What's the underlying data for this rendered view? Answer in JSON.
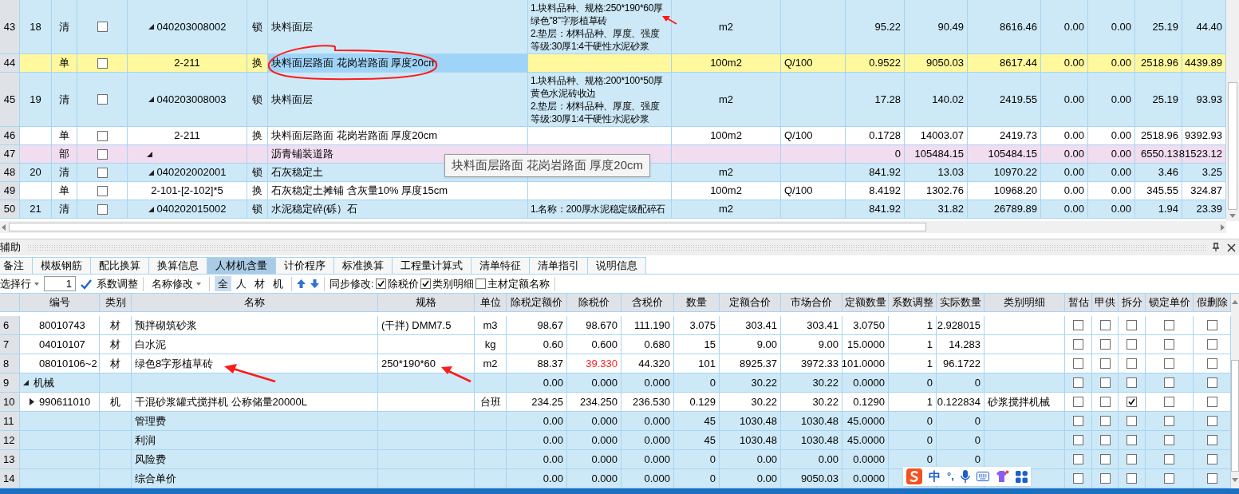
{
  "top_table": {
    "rows": [
      {
        "row": "43",
        "seq": "18",
        "type": "清",
        "kind": "list",
        "selected": false,
        "checked": false,
        "expanded": true,
        "code": "040203008002",
        "lock": "锁",
        "name": "块料面层",
        "desc": [
          "1.块料品种、规格:250*190*60厚",
          "绿色\"8\"字形植草砖",
          "2.垫层：材料品种、厚度、强度",
          "等级:30厚1:4干硬性水泥砂浆"
        ],
        "unit": "m2",
        "expr": "",
        "values": [
          "95.22",
          "90.49",
          "8616.46",
          "0.00",
          "0.00",
          "25.19",
          "44.40"
        ]
      },
      {
        "row": "44",
        "seq": "",
        "type": "单",
        "kind": "quota",
        "selected": true,
        "checked": false,
        "code": "2-211",
        "lock": "换",
        "name": "块料面层路面 花岗岩路面 厚度20cm",
        "desc": [],
        "unit": "100m2",
        "expr": "Q/100",
        "values": [
          "0.9522",
          "9050.03",
          "8617.44",
          "0.00",
          "0.00",
          "2518.96",
          "4439.89"
        ]
      },
      {
        "row": "45",
        "seq": "19",
        "type": "清",
        "kind": "list",
        "selected": false,
        "checked": false,
        "expanded": true,
        "code": "040203008003",
        "lock": "锁",
        "name": "块料面层",
        "desc": [
          "1.块料品种、规格:200*100*50厚",
          "黄色水泥砖收边",
          "2.垫层：材料品种、厚度、强度",
          "等级:30厚1:4干硬性水泥砂浆"
        ],
        "unit": "m2",
        "expr": "",
        "values": [
          "17.28",
          "140.02",
          "2419.55",
          "0.00",
          "0.00",
          "25.19",
          "93.93"
        ]
      },
      {
        "row": "46",
        "seq": "",
        "type": "单",
        "kind": "quota",
        "selected": false,
        "checked": false,
        "code": "2-211",
        "lock": "换",
        "name": "块料面层路面 花岗岩路面 厚度20cm",
        "desc": [],
        "unit": "100m2",
        "expr": "Q/100",
        "values": [
          "0.1728",
          "14003.07",
          "2419.73",
          "0.00",
          "0.00",
          "2518.96",
          "9392.93"
        ]
      },
      {
        "row": "47",
        "seq": "",
        "type": "部",
        "kind": "section",
        "selected": false,
        "checked": false,
        "expanded": true,
        "code": "",
        "lock": "",
        "name": "沥青铺装道路",
        "desc": [],
        "unit": "",
        "expr": "",
        "values": [
          "0",
          "105484.15",
          "105484.15",
          "0.00",
          "0.00",
          "6550.13",
          "81523.12"
        ]
      },
      {
        "row": "48",
        "seq": "20",
        "type": "清",
        "kind": "list",
        "selected": false,
        "checked": false,
        "expanded": true,
        "code": "040202002001",
        "lock": "锁",
        "name": "石灰稳定土",
        "desc": [],
        "unit": "m2",
        "expr": "",
        "values": [
          "841.92",
          "13.03",
          "10970.22",
          "0.00",
          "0.00",
          "3.46",
          "3.25"
        ]
      },
      {
        "row": "49",
        "seq": "",
        "type": "单",
        "kind": "quota",
        "selected": false,
        "checked": false,
        "code": "2-101-[2-102]*5",
        "lock": "换",
        "name": "石灰稳定土摊铺 含灰量10% 厚度15cm",
        "desc": [],
        "unit": "100m2",
        "expr": "Q/100",
        "values": [
          "8.4192",
          "1302.76",
          "10968.20",
          "0.00",
          "0.00",
          "345.55",
          "324.87"
        ]
      },
      {
        "row": "50",
        "seq": "21",
        "type": "清",
        "kind": "list",
        "selected": false,
        "checked": false,
        "expanded": true,
        "code": "040202015002",
        "lock": "锁",
        "name": "水泥稳定碎(砾）石",
        "desc": [
          "1.名称：200厚水泥稳定级配碎石"
        ],
        "unit": "m2",
        "expr": "",
        "values": [
          "841.92",
          "31.82",
          "26789.89",
          "0.00",
          "0.00",
          "1.94",
          "23.39"
        ]
      }
    ]
  },
  "tooltip": "块料面层路面 花岗岩路面 厚度20cm",
  "panel": {
    "title": "辅助",
    "tabs": [
      {
        "label": "备注",
        "selected": false
      },
      {
        "label": "模板钢筋",
        "selected": false
      },
      {
        "label": "配比换算",
        "selected": false
      },
      {
        "label": "换算信息",
        "selected": false
      },
      {
        "label": "人材机含量",
        "selected": true
      },
      {
        "label": "计价程序",
        "selected": false
      },
      {
        "label": "标准换算",
        "selected": false
      },
      {
        "label": "工程量计算式",
        "selected": false
      },
      {
        "label": "清单特征",
        "selected": false
      },
      {
        "label": "清单指引",
        "selected": false
      },
      {
        "label": "说明信息",
        "selected": false
      }
    ],
    "toolbar": {
      "select_row": "选择行",
      "row_value": "1",
      "coef_adjust": "系数调整",
      "rename": "名称修改",
      "filters": [
        {
          "label": "全",
          "selected": true
        },
        {
          "label": "人",
          "selected": false
        },
        {
          "label": "材",
          "selected": false
        },
        {
          "label": "机",
          "selected": false
        }
      ],
      "sync_label": "同步修改:",
      "sync_options": [
        {
          "label": "除税价",
          "checked": true
        },
        {
          "label": "类别明细",
          "checked": true
        },
        {
          "label": "主材定额名称",
          "checked": false
        }
      ]
    },
    "columns": [
      "编号",
      "类别",
      "名称",
      "规格",
      "单位",
      "除税定额价",
      "除税价",
      "含税价",
      "数量",
      "定额合价",
      "市场合价",
      "定额数量",
      "系数调整",
      "实际数量",
      "类别明细",
      "暂估",
      "甲供",
      "拆分",
      "锁定单价",
      "假删除"
    ],
    "rows": [
      {
        "row": "6",
        "kind": "item",
        "code": "80010743",
        "type": "材",
        "name": "预拌砌筑砂浆",
        "spec": "(干拌) DMM7.5",
        "unit": "m3",
        "price_modified": false,
        "values": [
          "98.67",
          "98.670",
          "111.190",
          "3.075",
          "303.41",
          "303.41",
          "3.0750",
          "1",
          "2.928015"
        ],
        "detail": "",
        "checks": [
          false,
          false,
          false,
          false,
          false
        ]
      },
      {
        "row": "7",
        "kind": "item",
        "code": "04010107",
        "type": "材",
        "name": "白水泥",
        "spec": "",
        "unit": "kg",
        "price_modified": false,
        "values": [
          "0.60",
          "0.600",
          "0.680",
          "15",
          "9.00",
          "9.00",
          "15.0000",
          "1",
          "14.283"
        ],
        "detail": "",
        "checks": [
          false,
          false,
          false,
          false,
          false
        ]
      },
      {
        "row": "8",
        "kind": "item",
        "code": "08010106~2",
        "type": "材",
        "name": "绿色8字形植草砖",
        "spec": "250*190*60",
        "unit": "m2",
        "price_modified": true,
        "values": [
          "88.37",
          "39.330",
          "44.320",
          "101",
          "8925.37",
          "3972.33",
          "101.0000",
          "1",
          "96.1722"
        ],
        "detail": "",
        "checks": [
          false,
          false,
          false,
          false,
          false
        ]
      },
      {
        "row": "9",
        "kind": "group",
        "expanded": true,
        "code": "机械",
        "type": "",
        "name": "",
        "spec": "",
        "unit": "",
        "price_modified": false,
        "values": [
          "0.00",
          "0.000",
          "0.000",
          "0",
          "30.22",
          "30.22",
          "0.0000",
          "0",
          "0"
        ],
        "detail": "",
        "checks": [
          false,
          false,
          false,
          false,
          false
        ]
      },
      {
        "row": "10",
        "kind": "item",
        "expanded": false,
        "code": "990611010",
        "type": "机",
        "name": "干混砂浆罐式搅拌机 公称储量20000L",
        "spec": "",
        "unit": "台班",
        "price_modified": false,
        "values": [
          "234.25",
          "234.250",
          "236.530",
          "0.129",
          "30.22",
          "30.22",
          "0.1290",
          "1",
          "0.122834"
        ],
        "detail": "砂浆搅拌机械",
        "checks": [
          false,
          false,
          true,
          false,
          false
        ]
      },
      {
        "row": "11",
        "kind": "fee",
        "code": "",
        "type": "",
        "name": "管理费",
        "spec": "",
        "unit": "",
        "price_modified": false,
        "values": [
          "0.00",
          "0.000",
          "0.000",
          "45",
          "1030.48",
          "1030.48",
          "45.0000",
          "0",
          "0"
        ],
        "detail": "",
        "checks": [
          false,
          false,
          false,
          false,
          false
        ]
      },
      {
        "row": "12",
        "kind": "fee",
        "code": "",
        "type": "",
        "name": "利润",
        "spec": "",
        "unit": "",
        "price_modified": false,
        "values": [
          "0.00",
          "0.000",
          "0.000",
          "45",
          "1030.48",
          "1030.48",
          "45.0000",
          "0",
          "0"
        ],
        "detail": "",
        "checks": [
          false,
          false,
          false,
          false,
          false
        ]
      },
      {
        "row": "13",
        "kind": "fee",
        "code": "",
        "type": "",
        "name": "风险费",
        "spec": "",
        "unit": "",
        "price_modified": false,
        "values": [
          "0.00",
          "0.000",
          "0.000",
          "0",
          "0.00",
          "0.00",
          "0.0000",
          "0",
          "0"
        ],
        "detail": "",
        "checks": [
          false,
          false,
          false,
          false,
          false
        ]
      },
      {
        "row": "14",
        "kind": "fee",
        "code": "",
        "type": "",
        "name": "综合单价",
        "spec": "",
        "unit": "",
        "price_modified": false,
        "values": [
          "0.00",
          "0.000",
          "0.000",
          "0",
          "0.00",
          "9050.03",
          "0.0000"
        ],
        "detail": "",
        "checks": [
          false,
          false,
          false,
          false,
          false
        ]
      }
    ]
  },
  "ime_bar": {
    "mode": "中",
    "punctuation": "°,"
  }
}
